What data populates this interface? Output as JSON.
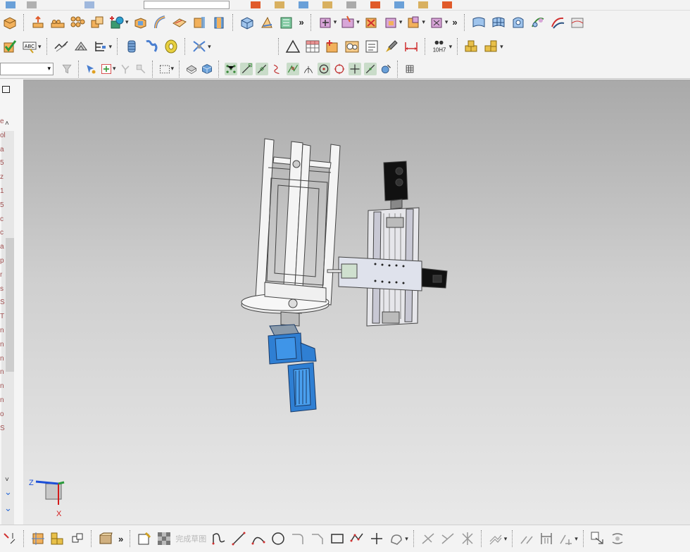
{
  "colors": {
    "accent": "#ff8a00",
    "toolbar_bg": "#f3f3f3",
    "motor_blue": "#2f7fd3",
    "axis_z": "#1c4fd8",
    "axis_x": "#d31b1b"
  },
  "toolbar": {
    "more_glyph": "»",
    "dropdown_glyph": "▾",
    "tolerance_label": "10H7",
    "abc_label": "ABC"
  },
  "left_panel": {
    "scroll_up": "˄",
    "scroll_down": "˅",
    "visible_fragments": [
      "e",
      "ol",
      "a",
      "5",
      "z",
      "1",
      "5",
      "c",
      "c",
      "a",
      "p",
      "r",
      "s",
      "S",
      "T",
      "n",
      "n",
      "n",
      "n",
      "n",
      "n",
      "o",
      "S"
    ]
  },
  "triad": {
    "z_label": "Z",
    "x_label": "X"
  },
  "bottom_toolbar": {
    "finish_sketch_label": "完成草图"
  }
}
